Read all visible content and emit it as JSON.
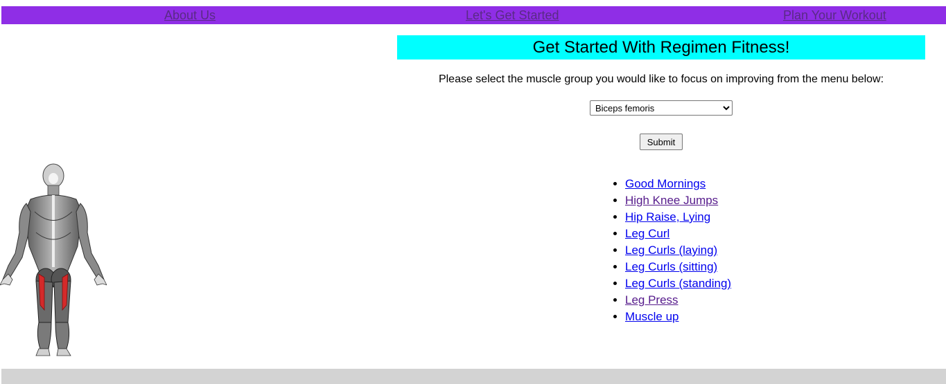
{
  "nav": {
    "about": "About Us",
    "start": "Let's Get Started",
    "plan": "Plan Your Workout"
  },
  "banner": {
    "title": "Get Started With Regimen Fitness!"
  },
  "instruction": "Please select the muscle group you would like to focus on improving from the menu below:",
  "muscle_select": {
    "selected": "Biceps femoris"
  },
  "submit_label": "Submit",
  "exercises": [
    "Good Mornings",
    "High Knee Jumps",
    "Hip Raise, Lying",
    "Leg Curl",
    "Leg Curls (laying)",
    "Leg Curls (sitting)",
    "Leg Curls (standing)",
    "Leg Press",
    "Muscle up"
  ],
  "colors": {
    "navbar": "#8f2ee6",
    "banner": "#00ffff",
    "footer": "#d3d3d3",
    "link": "#0000ee",
    "visited_link": "#551a8b",
    "highlight_muscle": "#d42a2a"
  }
}
